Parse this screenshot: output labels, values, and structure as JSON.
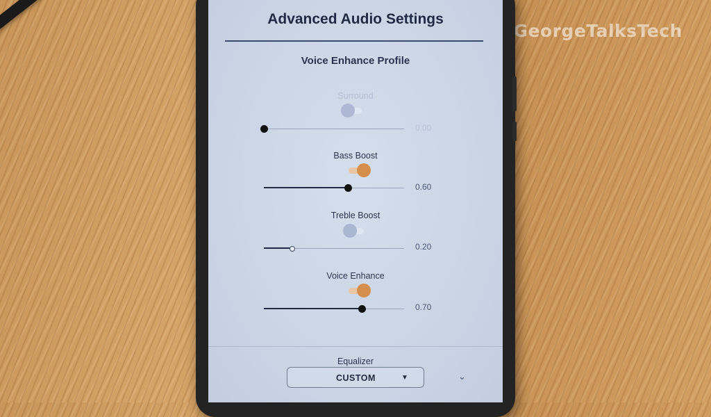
{
  "header": {
    "title": "Advanced Audio Settings"
  },
  "profile": {
    "label": "Voice Enhance Profile"
  },
  "effects": [
    {
      "label": "Surround",
      "enabled": false,
      "level": 0.0,
      "value_text": "0.00"
    },
    {
      "label": "Bass Boost",
      "enabled": true,
      "level": 0.6,
      "value_text": "0.60"
    },
    {
      "label": "Treble Boost",
      "enabled": false,
      "level": 0.2,
      "value_text": "0.20"
    },
    {
      "label": "Voice Enhance",
      "enabled": true,
      "level": 0.7,
      "value_text": "0.70"
    }
  ],
  "equalizer": {
    "label": "Equalizer",
    "selected": "CUSTOM"
  },
  "icons": {
    "dropdown": "caret-down-icon",
    "expand": "chevron-down-icon"
  },
  "watermark": "#GeorgeTalksTech",
  "colors": {
    "accent": "#d48f4d",
    "text": "#1f2a44",
    "screen": "#ccd6e6"
  }
}
